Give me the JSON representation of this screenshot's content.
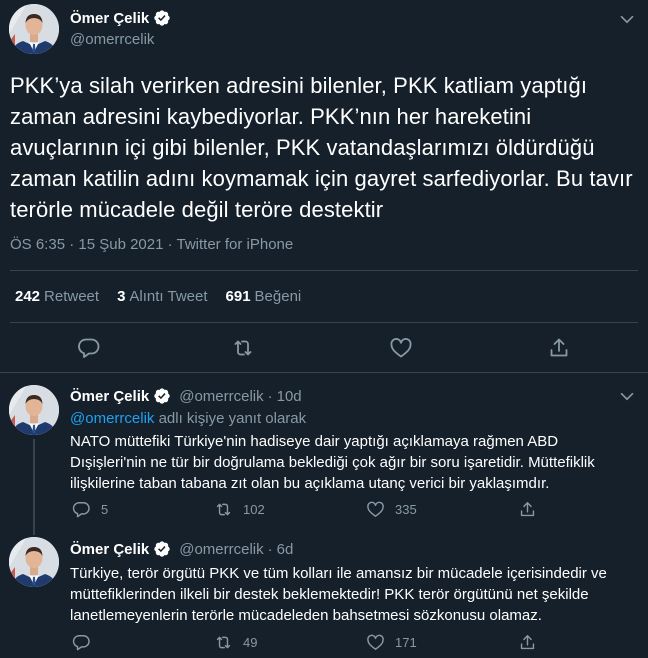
{
  "main_tweet": {
    "author_name": "Ömer Çelik",
    "author_handle": "@omerrcelik",
    "text": "PKK’ya silah verirken adresini bilenler, PKK katliam yaptığı zaman adresini kaybediyorlar. PKK’nın her hareketini avuçlarının içi gibi bilenler, PKK vatandaşlarımızı öldürdüğü zaman katilin adını koymamak için gayret sarfediyorlar. Bu tavır terörle mücadele değil teröre destektir",
    "meta": "ÖS 6:35 · 15 Şub 2021 · Twitter for iPhone",
    "stats": {
      "retweets_count": "242",
      "retweets_label": "Retweet",
      "quotes_count": "3",
      "quotes_label": "Alıntı Tweet",
      "likes_count": "691",
      "likes_label": "Beğeni"
    }
  },
  "replies": [
    {
      "author_name": "Ömer Çelik",
      "author_handle": "@omerrcelik",
      "time": "10d",
      "reply_to_mention": "@omerrcelik",
      "reply_to_suffix": " adlı kişiye yanıt olarak",
      "text": "NATO müttefiki Türkiye'nin hadiseye dair yaptığı açıklamaya rağmen ABD Dışişleri'nin ne tür bir doğrulama beklediği çok ağır bir soru işaretidir. Müttefiklik ilişkilerine taban tabana zıt olan bu açıklama utanç verici bir yaklaşımdır.",
      "reply_count": "5",
      "retweet_count": "102",
      "like_count": "335"
    },
    {
      "author_name": "Ömer Çelik",
      "author_handle": "@omerrcelik",
      "time": "6d",
      "text": "Türkiye, terör örgütü PKK ve tüm kolları ile amansız bir mücadele içerisindedir ve müttefiklerinden ilkeli bir destek beklemektedir! PKK terör örgütünü net şekilde lanetlemeyenlerin terörle mücadeleden bahsetmesi sözkonusu olamaz.",
      "reply_count": "",
      "retweet_count": "49",
      "like_count": "171"
    }
  ],
  "icons": {
    "more": "more-icon",
    "verified": "verified-badge-icon",
    "reply": "reply-icon",
    "retweet": "retweet-icon",
    "like": "like-icon",
    "share": "share-icon"
  },
  "colors": {
    "background": "#15202b",
    "secondary_text": "#8899a6",
    "accent": "#1da1f2",
    "divider": "#38444d"
  }
}
